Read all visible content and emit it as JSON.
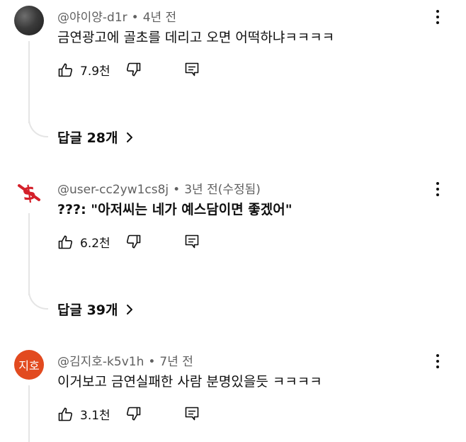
{
  "comments": [
    {
      "author": "@야이양-d1r",
      "time": "4년 전",
      "text": "금연광고에 골초를 데리고 오면 어떡하냐ㅋㅋㅋㅋ",
      "likes": "7.9천",
      "replies": "답글 28개",
      "avatar_icon": "avatar-photo-dark"
    },
    {
      "author": "@user-cc2yw1cs8j",
      "time": "3년 전(수정됨)",
      "text": "???: \"아저씨는 네가 예스담이면 좋겠어\"",
      "likes": "6.2천",
      "replies": "답글 39개",
      "avatar_icon": "no-money-logo-icon"
    },
    {
      "author": "@김지호-k5v1h",
      "time": "7년 전",
      "text": "이거보고 금연실패한 사람 분명있을듯 ㅋㅋㅋㅋ",
      "likes": "3.1천",
      "avatar_initial": "지호",
      "avatar_color": "#e24a1f"
    }
  ],
  "separator": "•",
  "icons": {
    "like": "thumbs-up-icon",
    "dislike": "thumbs-down-icon",
    "reply": "reply-comment-icon",
    "more": "more-vertical-icon",
    "expand": "chevron-right-icon"
  }
}
